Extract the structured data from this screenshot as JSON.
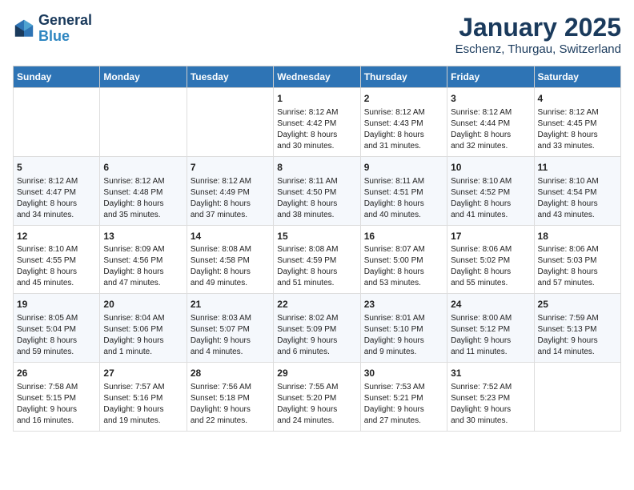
{
  "logo": {
    "line1": "General",
    "line2": "Blue"
  },
  "title": "January 2025",
  "subtitle": "Eschenz, Thurgau, Switzerland",
  "days_of_week": [
    "Sunday",
    "Monday",
    "Tuesday",
    "Wednesday",
    "Thursday",
    "Friday",
    "Saturday"
  ],
  "weeks": [
    [
      {
        "day": "",
        "info": ""
      },
      {
        "day": "",
        "info": ""
      },
      {
        "day": "",
        "info": ""
      },
      {
        "day": "1",
        "info": "Sunrise: 8:12 AM\nSunset: 4:42 PM\nDaylight: 8 hours\nand 30 minutes."
      },
      {
        "day": "2",
        "info": "Sunrise: 8:12 AM\nSunset: 4:43 PM\nDaylight: 8 hours\nand 31 minutes."
      },
      {
        "day": "3",
        "info": "Sunrise: 8:12 AM\nSunset: 4:44 PM\nDaylight: 8 hours\nand 32 minutes."
      },
      {
        "day": "4",
        "info": "Sunrise: 8:12 AM\nSunset: 4:45 PM\nDaylight: 8 hours\nand 33 minutes."
      }
    ],
    [
      {
        "day": "5",
        "info": "Sunrise: 8:12 AM\nSunset: 4:47 PM\nDaylight: 8 hours\nand 34 minutes."
      },
      {
        "day": "6",
        "info": "Sunrise: 8:12 AM\nSunset: 4:48 PM\nDaylight: 8 hours\nand 35 minutes."
      },
      {
        "day": "7",
        "info": "Sunrise: 8:12 AM\nSunset: 4:49 PM\nDaylight: 8 hours\nand 37 minutes."
      },
      {
        "day": "8",
        "info": "Sunrise: 8:11 AM\nSunset: 4:50 PM\nDaylight: 8 hours\nand 38 minutes."
      },
      {
        "day": "9",
        "info": "Sunrise: 8:11 AM\nSunset: 4:51 PM\nDaylight: 8 hours\nand 40 minutes."
      },
      {
        "day": "10",
        "info": "Sunrise: 8:10 AM\nSunset: 4:52 PM\nDaylight: 8 hours\nand 41 minutes."
      },
      {
        "day": "11",
        "info": "Sunrise: 8:10 AM\nSunset: 4:54 PM\nDaylight: 8 hours\nand 43 minutes."
      }
    ],
    [
      {
        "day": "12",
        "info": "Sunrise: 8:10 AM\nSunset: 4:55 PM\nDaylight: 8 hours\nand 45 minutes."
      },
      {
        "day": "13",
        "info": "Sunrise: 8:09 AM\nSunset: 4:56 PM\nDaylight: 8 hours\nand 47 minutes."
      },
      {
        "day": "14",
        "info": "Sunrise: 8:08 AM\nSunset: 4:58 PM\nDaylight: 8 hours\nand 49 minutes."
      },
      {
        "day": "15",
        "info": "Sunrise: 8:08 AM\nSunset: 4:59 PM\nDaylight: 8 hours\nand 51 minutes."
      },
      {
        "day": "16",
        "info": "Sunrise: 8:07 AM\nSunset: 5:00 PM\nDaylight: 8 hours\nand 53 minutes."
      },
      {
        "day": "17",
        "info": "Sunrise: 8:06 AM\nSunset: 5:02 PM\nDaylight: 8 hours\nand 55 minutes."
      },
      {
        "day": "18",
        "info": "Sunrise: 8:06 AM\nSunset: 5:03 PM\nDaylight: 8 hours\nand 57 minutes."
      }
    ],
    [
      {
        "day": "19",
        "info": "Sunrise: 8:05 AM\nSunset: 5:04 PM\nDaylight: 8 hours\nand 59 minutes."
      },
      {
        "day": "20",
        "info": "Sunrise: 8:04 AM\nSunset: 5:06 PM\nDaylight: 9 hours\nand 1 minute."
      },
      {
        "day": "21",
        "info": "Sunrise: 8:03 AM\nSunset: 5:07 PM\nDaylight: 9 hours\nand 4 minutes."
      },
      {
        "day": "22",
        "info": "Sunrise: 8:02 AM\nSunset: 5:09 PM\nDaylight: 9 hours\nand 6 minutes."
      },
      {
        "day": "23",
        "info": "Sunrise: 8:01 AM\nSunset: 5:10 PM\nDaylight: 9 hours\nand 9 minutes."
      },
      {
        "day": "24",
        "info": "Sunrise: 8:00 AM\nSunset: 5:12 PM\nDaylight: 9 hours\nand 11 minutes."
      },
      {
        "day": "25",
        "info": "Sunrise: 7:59 AM\nSunset: 5:13 PM\nDaylight: 9 hours\nand 14 minutes."
      }
    ],
    [
      {
        "day": "26",
        "info": "Sunrise: 7:58 AM\nSunset: 5:15 PM\nDaylight: 9 hours\nand 16 minutes."
      },
      {
        "day": "27",
        "info": "Sunrise: 7:57 AM\nSunset: 5:16 PM\nDaylight: 9 hours\nand 19 minutes."
      },
      {
        "day": "28",
        "info": "Sunrise: 7:56 AM\nSunset: 5:18 PM\nDaylight: 9 hours\nand 22 minutes."
      },
      {
        "day": "29",
        "info": "Sunrise: 7:55 AM\nSunset: 5:20 PM\nDaylight: 9 hours\nand 24 minutes."
      },
      {
        "day": "30",
        "info": "Sunrise: 7:53 AM\nSunset: 5:21 PM\nDaylight: 9 hours\nand 27 minutes."
      },
      {
        "day": "31",
        "info": "Sunrise: 7:52 AM\nSunset: 5:23 PM\nDaylight: 9 hours\nand 30 minutes."
      },
      {
        "day": "",
        "info": ""
      }
    ]
  ]
}
